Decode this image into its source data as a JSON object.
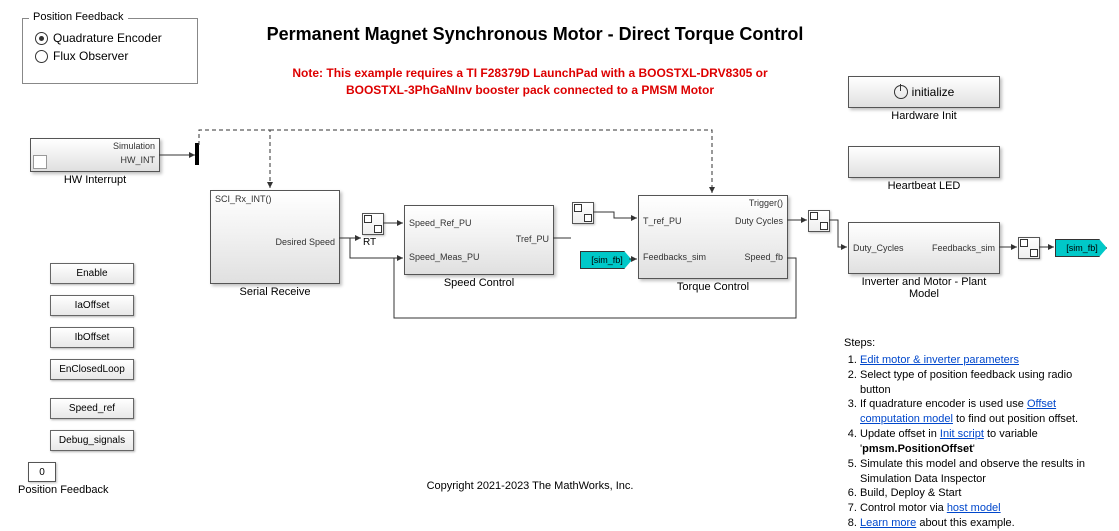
{
  "title": "Permanent Magnet Synchronous Motor - Direct Torque Control",
  "note_line1": "Note: This example requires a TI F28379D LaunchPad with a BOOSTXL-DRV8305 or",
  "note_line2": "BOOSTXL-3PhGaNInv booster pack connected to a PMSM Motor",
  "copyright": "Copyright 2021-2023 The MathWorks, Inc.",
  "feedback_panel": {
    "title": "Position Feedback",
    "option1": "Quadrature Encoder",
    "option2": "Flux Observer"
  },
  "hw_int_block": {
    "port": "HW_INT",
    "fn": "Simulation",
    "label": "HW Interrupt"
  },
  "data_stores": {
    "enable": "Enable",
    "ia": "IaOffset",
    "ib": "IbOffset",
    "closed": "EnClosedLoop",
    "speed": "Speed_ref",
    "debug": "Debug_signals"
  },
  "posfb_const": {
    "value": "0",
    "label": "Position Feedback"
  },
  "serial_rx": {
    "fn": "SCI_Rx_INT()",
    "out": "Desired Speed",
    "label": "Serial Receive"
  },
  "rt": {
    "label": "RT"
  },
  "speed_ctrl": {
    "in1": "Speed_Ref_PU",
    "in2": "Speed_Meas_PU",
    "out": "Tref_PU",
    "label": "Speed Control"
  },
  "torque_ctrl": {
    "fn": "Trigger()",
    "in1": "T_ref_PU",
    "in2": "Feedbacks_sim",
    "out1": "Duty Cycles",
    "out2": "Speed_fb",
    "label": "Torque Control"
  },
  "plant": {
    "in": "Duty_Cycles",
    "out": "Feedbacks_sim",
    "label": "Inverter and Motor - Plant Model"
  },
  "init_block": {
    "text": "initialize",
    "label": "Hardware Init"
  },
  "heartbeat": {
    "label": "Heartbeat LED"
  },
  "sim_fb": "[sim_fb]",
  "steps": {
    "heading": "Steps:",
    "s1a": "Edit motor & inverter parameters",
    "s2": "Select type of position feedback using radio button",
    "s3a": "If quadrature encoder is used use ",
    "s3b": "Offset computation model",
    "s3c": " to find out position offset.",
    "s4a": "Update offset in ",
    "s4b": "Init script",
    "s4c": " to variable '",
    "s4d": "pmsm.PositionOffset",
    "s4e": "'",
    "s5": "Simulate this model and observe the results in Simulation Data Inspector",
    "s6": "Build, Deploy & Start",
    "s7a": "Control motor via ",
    "s7b": "host model",
    "s8a": "Learn more",
    "s8b": " about this example."
  }
}
